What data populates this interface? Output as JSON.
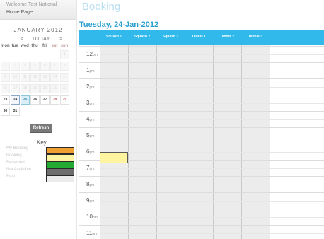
{
  "sidebar": {
    "welcome": "Welcome Test National",
    "home_link": "Home Page",
    "refresh_label": "Refresh"
  },
  "calendar": {
    "month_title": "JANUARY 2012",
    "prev_symbol": "<",
    "today_label": "TODAY",
    "next_symbol": ">",
    "close_symbol": "»",
    "weekdays": [
      "mon",
      "tue",
      "wed",
      "thu",
      "fri",
      "sat",
      "sun"
    ],
    "weeks": [
      [
        "",
        "",
        "",
        "",
        "",
        "",
        "1"
      ],
      [
        "2",
        "3",
        "4",
        "5",
        "6",
        "7",
        "8"
      ],
      [
        "9",
        "10",
        "11",
        "12",
        "13",
        "14",
        "15"
      ],
      [
        "16",
        "17",
        "18",
        "19",
        "20",
        "21",
        "22"
      ],
      [
        "23",
        "24",
        "25",
        "26",
        "27",
        "28",
        "29"
      ],
      [
        "30",
        "31",
        "",
        "",
        "",
        "",
        ""
      ]
    ],
    "selected_day": "24",
    "today_day": "25"
  },
  "key": {
    "title": "Key",
    "items": [
      {
        "label": "My Booking",
        "color": "#f0a030"
      },
      {
        "label": "Booking",
        "color": "#fff4a0"
      },
      {
        "label": "Reserved",
        "color": "#22aa33"
      },
      {
        "label": "Not Available",
        "color": "#6e6e6e"
      },
      {
        "label": "Free",
        "color": "#ececec"
      }
    ]
  },
  "main": {
    "page_title": "Booking",
    "date_heading": "Tuesday, 24-Jan-2012",
    "courts": [
      "Squash 1",
      "Squash 2",
      "Squash 3",
      "Tennis 1",
      "Tennis 2",
      "Tennis 3"
    ],
    "times": [
      {
        "hour": "12",
        "suffix": "pm"
      },
      {
        "hour": "1",
        "suffix": "pm"
      },
      {
        "hour": "2",
        "suffix": "pm"
      },
      {
        "hour": "3",
        "suffix": "pm"
      },
      {
        "hour": "4",
        "suffix": "pm"
      },
      {
        "hour": "5",
        "suffix": "pm"
      },
      {
        "hour": "6",
        "suffix": "pm"
      },
      {
        "hour": "7",
        "suffix": "pm"
      },
      {
        "hour": "8",
        "suffix": "pm"
      },
      {
        "hour": "9",
        "suffix": "pm"
      },
      {
        "hour": "10",
        "suffix": "pm"
      },
      {
        "hour": "11",
        "suffix": "pm"
      }
    ],
    "booking": {
      "court": "Squash 1",
      "time": "6pm",
      "status": "Booking"
    }
  },
  "colors": {
    "accent": "#30b9ea",
    "heading": "#2a9fd0",
    "title": "#b8def0"
  }
}
